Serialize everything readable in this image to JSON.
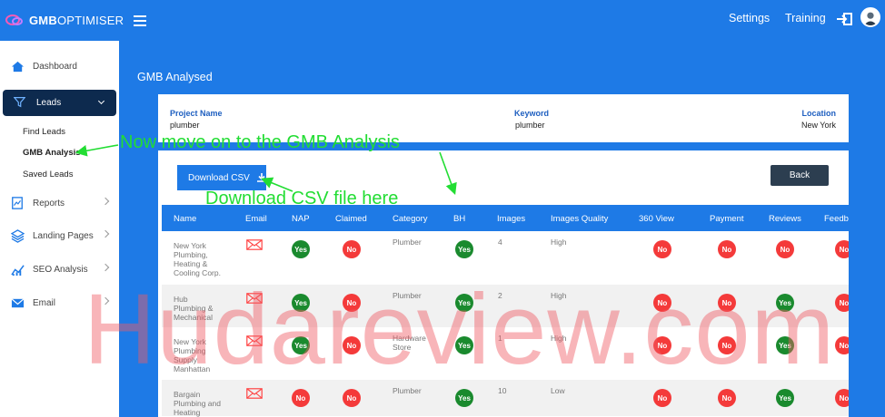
{
  "app": {
    "logo_bold": "GMB",
    "logo_light": "OPTIMISER",
    "nav": {
      "settings": "Settings",
      "training": "Training"
    }
  },
  "sidebar": {
    "items": [
      {
        "label": "Dashboard",
        "icon": "home-icon"
      },
      {
        "label": "Leads",
        "icon": "filter-icon"
      },
      {
        "label": "Reports",
        "icon": "report-icon"
      },
      {
        "label": "Landing Pages",
        "icon": "layers-icon"
      },
      {
        "label": "SEO Analysis",
        "icon": "chart-icon"
      },
      {
        "label": "Email",
        "icon": "email-icon"
      }
    ],
    "sub_items": [
      "Find Leads",
      "GMB Analysis",
      "Saved Leads"
    ]
  },
  "page": {
    "title": "GMB Analysed",
    "project_label": "Project Name",
    "project_value": "plumber",
    "keyword_label": "Keyword",
    "keyword_value": "plumber",
    "location_label": "Location",
    "location_value": "New York",
    "download_label": "Download CSV",
    "back_label": "Back"
  },
  "table": {
    "headers": [
      "Name",
      "Email",
      "NAP",
      "Claimed",
      "Category",
      "BH",
      "Images",
      "Images Quality",
      "360 View",
      "Payment",
      "Reviews",
      "Feedb"
    ],
    "rows": [
      {
        "name": [
          "New York",
          "Plumbing,",
          "Heating &",
          "Cooling Corp."
        ],
        "nap": "Yes",
        "claimed": "No",
        "category": [
          "Plumber"
        ],
        "bh": "Yes",
        "images": "4",
        "quality": "High",
        "view360": "No",
        "payment": "No",
        "reviews": "No",
        "feedback": "No"
      },
      {
        "name": [
          "Hub",
          "Plumbing &",
          "Mechanical"
        ],
        "nap": "Yes",
        "claimed": "No",
        "category": [
          "Plumber"
        ],
        "bh": "Yes",
        "images": "2",
        "quality": "High",
        "view360": "No",
        "payment": "No",
        "reviews": "Yes",
        "feedback": "No"
      },
      {
        "name": [
          "New York",
          "Plumbing",
          "Supply",
          "Manhattan"
        ],
        "nap": "Yes",
        "claimed": "No",
        "category": [
          "Hardware",
          "Store"
        ],
        "bh": "Yes",
        "images": "1",
        "quality": "High",
        "view360": "No",
        "payment": "No",
        "reviews": "Yes",
        "feedback": "No"
      },
      {
        "name": [
          "Bargain",
          "Plumbing and",
          "Heating"
        ],
        "nap": "No",
        "claimed": "No",
        "category": [
          "Plumber"
        ],
        "bh": "Yes",
        "images": "10",
        "quality": "Low",
        "view360": "No",
        "payment": "No",
        "reviews": "Yes",
        "feedback": "No"
      }
    ]
  },
  "annotations": {
    "gmb_note": "Now move on to the GMB Analysis",
    "csv_note": "Download CSV file here",
    "watermark": "Hudareview.com"
  },
  "colors": {
    "primary": "#1e7ae6",
    "sidebar_active": "#0d2a4e",
    "yes": "#1a8a2e",
    "no": "#f43a3a",
    "annotation": "#22dd33"
  }
}
